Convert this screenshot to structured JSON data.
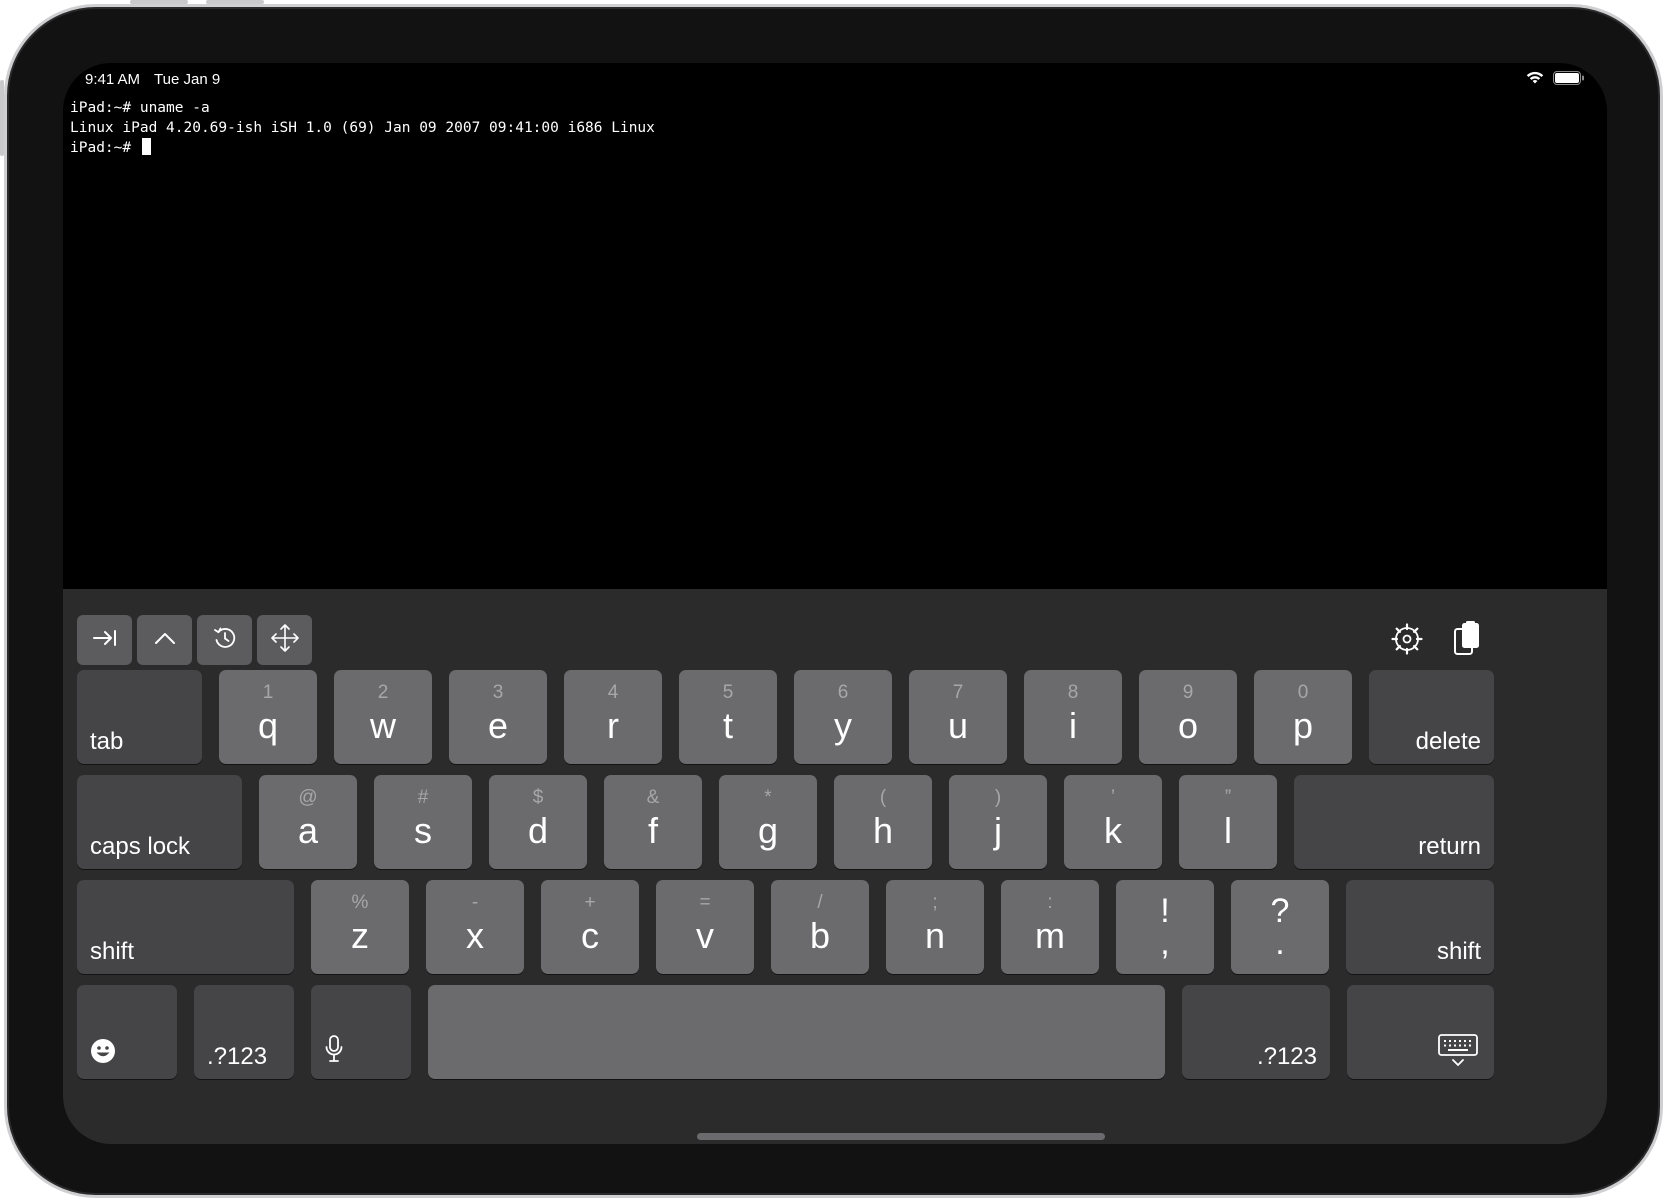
{
  "status_bar": {
    "time": "9:41 AM",
    "date": "Tue Jan 9"
  },
  "terminal": {
    "lines": [
      "iPad:~# uname -a",
      "Linux iPad 4.20.69-ish iSH 1.0 (69) Jan 09 2007 09:41:00 i686 Linux"
    ],
    "prompt": "iPad:~# "
  },
  "toolbar": {
    "left_icons": [
      "tab-arrow-icon",
      "control-caret-icon",
      "history-icon",
      "arrow-keys-icon"
    ],
    "right_icons": [
      "settings-gear-icon",
      "paste-clipboard-icon"
    ]
  },
  "keyboard": {
    "row1": [
      {
        "main": "q",
        "hint": "1"
      },
      {
        "main": "w",
        "hint": "2"
      },
      {
        "main": "e",
        "hint": "3"
      },
      {
        "main": "r",
        "hint": "4"
      },
      {
        "main": "t",
        "hint": "5"
      },
      {
        "main": "y",
        "hint": "6"
      },
      {
        "main": "u",
        "hint": "7"
      },
      {
        "main": "i",
        "hint": "8"
      },
      {
        "main": "o",
        "hint": "9"
      },
      {
        "main": "p",
        "hint": "0"
      }
    ],
    "row2": [
      {
        "main": "a",
        "hint": "@"
      },
      {
        "main": "s",
        "hint": "#"
      },
      {
        "main": "d",
        "hint": "$"
      },
      {
        "main": "f",
        "hint": "&"
      },
      {
        "main": "g",
        "hint": "*"
      },
      {
        "main": "h",
        "hint": "("
      },
      {
        "main": "j",
        "hint": ")"
      },
      {
        "main": "k",
        "hint": "’"
      },
      {
        "main": "l",
        "hint": "”"
      }
    ],
    "row3": [
      {
        "main": "z",
        "hint": "%"
      },
      {
        "main": "x",
        "hint": "-"
      },
      {
        "main": "c",
        "hint": "+"
      },
      {
        "main": "v",
        "hint": "="
      },
      {
        "main": "b",
        "hint": "/"
      },
      {
        "main": "n",
        "hint": ";"
      },
      {
        "main": "m",
        "hint": ":"
      }
    ],
    "punct": [
      {
        "top": "!",
        "bottom": ","
      },
      {
        "top": "?",
        "bottom": "."
      }
    ],
    "labels": {
      "tab": "tab",
      "delete": "delete",
      "caps_lock": "caps lock",
      "return": "return",
      "shift_left": "shift",
      "shift_right": "shift",
      "numbers_left": ".?123",
      "numbers_right": ".?123"
    }
  },
  "colors": {
    "terminal_bg": "#000000",
    "keyboard_bg": "#2b2b2b",
    "letter_key": "#6b6b6d",
    "function_key": "#454547"
  }
}
